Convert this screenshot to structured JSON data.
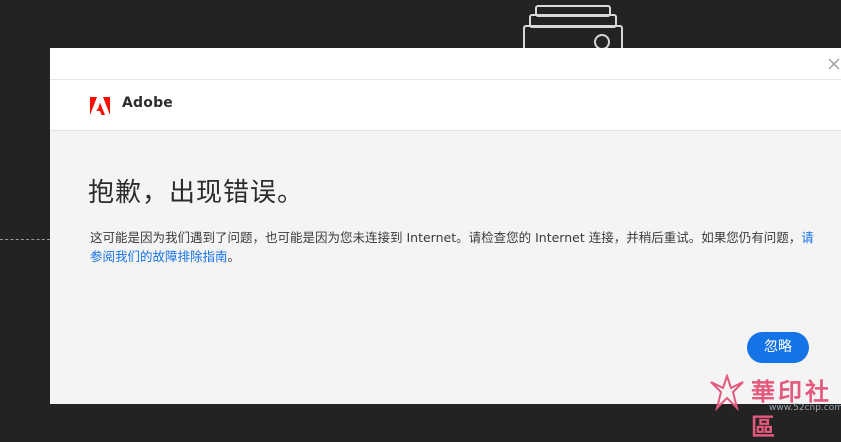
{
  "colors": {
    "backdrop": "#232323",
    "dialog_bg": "#f4f4f4",
    "header_bg": "#ffffff",
    "adobe_red": "#fa0f00",
    "accent_blue": "#1473e6",
    "text_dark": "#2c2c2c",
    "watermark_pink": "#e35a7d"
  },
  "background": {
    "icon": "photo-stack-icon"
  },
  "dialog": {
    "close_icon": "close-icon",
    "brand": {
      "logo_icon": "adobe-logo-icon",
      "name": "Adobe"
    },
    "heading": "抱歉，出现错误。",
    "message_text": "这可能是因为我们遇到了问题，也可能是因为您未连接到 Internet。请检查您的 Internet 连接，并稍后重试。如果您仍有问题，",
    "help_link": "请参阅我们的故障排除指南",
    "message_end": "。",
    "ignore_button": "忽略"
  },
  "watermark": {
    "text": "華印社區",
    "url": "www.52cnp.com"
  }
}
